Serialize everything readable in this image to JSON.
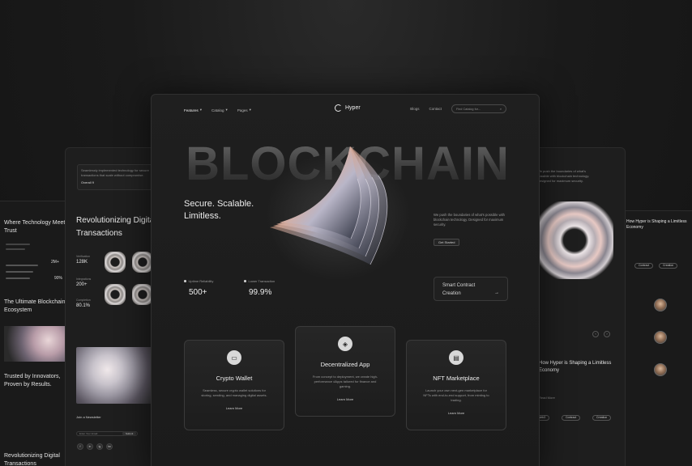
{
  "main": {
    "nav": {
      "links": [
        "Features",
        "Catalog",
        "Pages"
      ],
      "logo": "Hyper",
      "right_links": [
        "Blogs",
        "Contact"
      ],
      "search_placeholder": "Find Catalog for..."
    },
    "big_word": "BLOCKCHAIN",
    "hero_title": "Secure. Scalable. Limitless.",
    "hero_copy": "We push the boundaries of what's possible with blockchain technology. Designed for maximum security.",
    "hero_button": "Get Started",
    "stats": [
      {
        "label": "Uptime Reliability",
        "value": "500+"
      },
      {
        "label": "Lower Transaction",
        "value": "99.9%"
      }
    ],
    "smart_contract": {
      "line1": "Smart Contract",
      "line2": "Creation",
      "arrow": "→"
    },
    "cards": [
      {
        "title": "Crypto Wallet",
        "desc": "Seamless, secure crypto wallet solutions for storing, sending, and managing digital assets.",
        "more": "Learn More",
        "icon": "wallet-icon",
        "glyph": "▭"
      },
      {
        "title": "Decentralized App",
        "desc": "From concept to deployment, we create high-performance dApps tailored for finance and gaming.",
        "more": "Learn More",
        "icon": "cube-icon",
        "glyph": "◈"
      },
      {
        "title": "NFT Marketplace",
        "desc": "Launch your own next-gen marketplace for NFTs with end-to-end support, from minting to trading.",
        "more": "Learn More",
        "icon": "store-icon",
        "glyph": "▤"
      }
    ]
  },
  "left_panel": {
    "box_text": "Seamlessly implemented technology for secure transactions that scale without compromise.",
    "box_label": "Overall 9",
    "title": "Revolutionizing Digital Transactions",
    "stats": [
      {
        "label": "Verification",
        "value": "128K"
      },
      {
        "label": "Integrations",
        "value": "200+"
      },
      {
        "label": "Completion",
        "value": "80.1%"
      }
    ],
    "newsletter": "Join a Newsletter",
    "input_placeholder": "Enter Your Email",
    "submit": "Submit",
    "socials": [
      "f",
      "in",
      "ig",
      "tw"
    ]
  },
  "far_left_panel": {
    "title1": "Where Technology Meets Trust",
    "title2": "The Ultimate Blockchain Ecosystem",
    "title3": "Trusted by Innovators, Proven by Results.",
    "title4": "Revolutionizing Digital Transactions",
    "value1": "2M+",
    "value2": "90%"
  },
  "right_panel": {
    "title": "How Hyper is Shaping a Limitless Economy",
    "read_more": "Read More",
    "pills": [
      "Web3",
      "Contract",
      "Creation"
    ]
  },
  "far_right_panel": {
    "title": "How Hyper is Shaping a Limitless Economy",
    "pills": [
      "Contract",
      "Creation"
    ]
  }
}
